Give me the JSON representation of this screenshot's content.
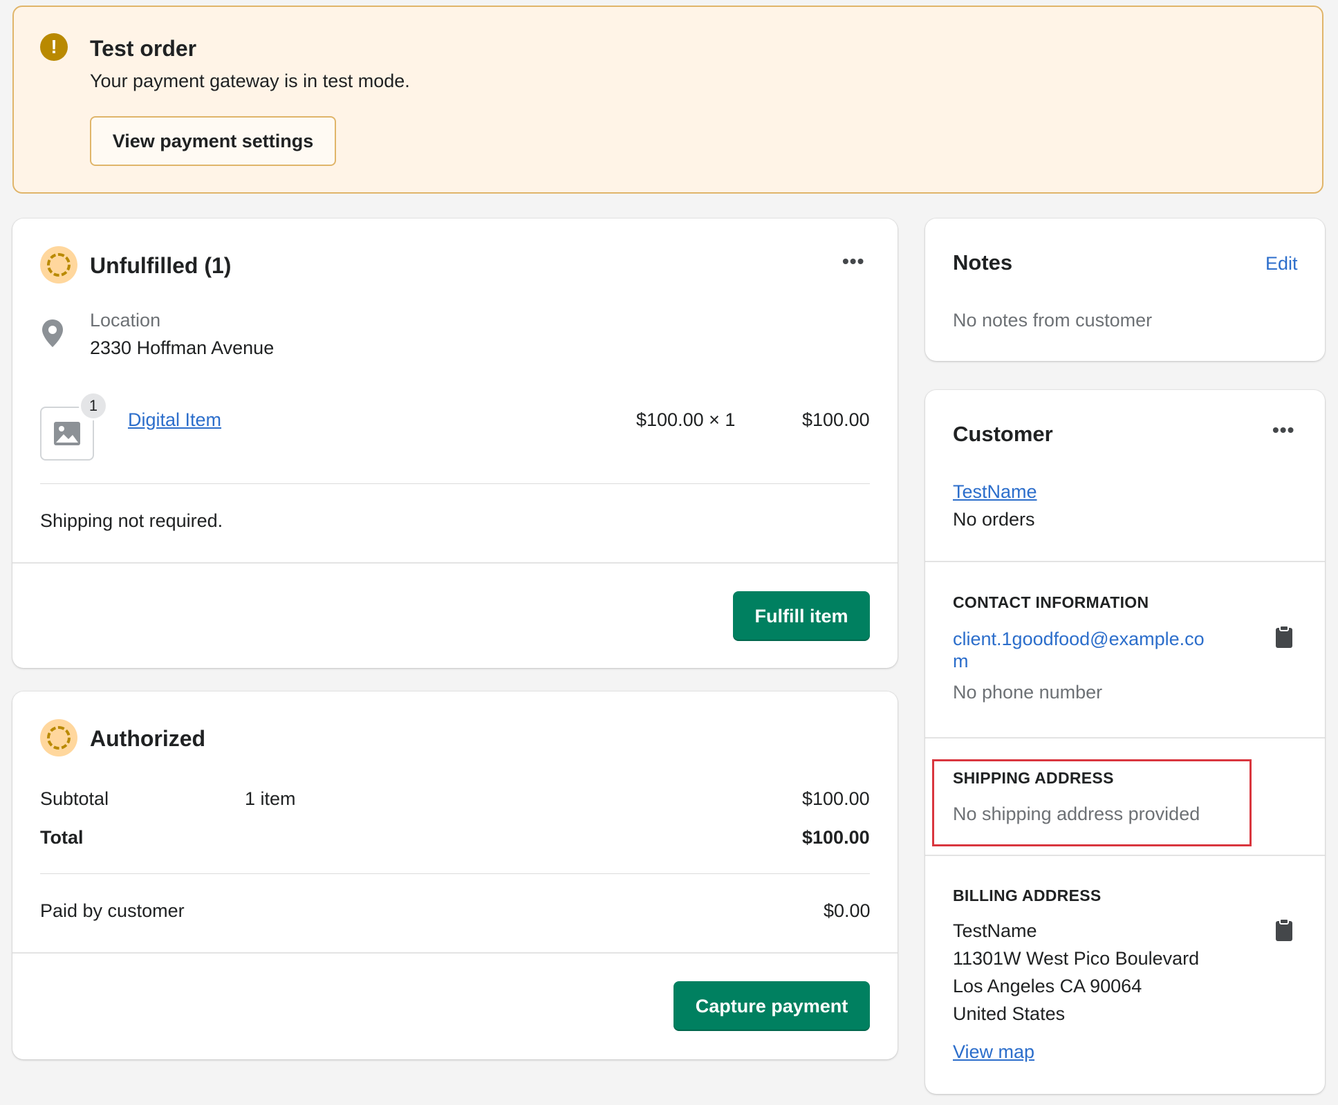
{
  "banner": {
    "title": "Test order",
    "message": "Your payment gateway is in test mode.",
    "button_label": "View payment settings",
    "icon": "warning-icon",
    "icon_glyph": "!"
  },
  "fulfillment": {
    "title": "Unfulfilled (1)",
    "more_label": "•••",
    "location_label": "Location",
    "location_value": "2330 Hoffman Avenue",
    "item": {
      "quantity_badge": "1",
      "name": "Digital Item",
      "unit_price": "$100.00 × 1",
      "line_total": "$100.00"
    },
    "shipping_note": "Shipping not required.",
    "action_label": "Fulfill item"
  },
  "payment": {
    "title": "Authorized",
    "subtotal_label": "Subtotal",
    "subtotal_items": "1 item",
    "subtotal_value": "$100.00",
    "total_label": "Total",
    "total_value": "$100.00",
    "paid_label": "Paid by customer",
    "paid_value": "$0.00",
    "action_label": "Capture payment"
  },
  "notes": {
    "title": "Notes",
    "edit_label": "Edit",
    "body": "No notes from customer"
  },
  "customer": {
    "title": "Customer",
    "more_label": "•••",
    "name": "TestName",
    "orders": "No orders",
    "contact_heading": "CONTACT INFORMATION",
    "email_line1": "client.1goodfood@example.co",
    "email_line2": "m",
    "phone": "No phone number",
    "shipping_heading": "SHIPPING ADDRESS",
    "shipping_value": "No shipping address provided",
    "billing_heading": "BILLING ADDRESS",
    "billing_lines": [
      "TestName",
      "11301W West Pico Boulevard",
      "Los Angeles CA 90064",
      "United States"
    ],
    "view_map_label": "View map"
  },
  "colors": {
    "primary": "#008060",
    "link": "#2c6ecb",
    "warning_bg": "#fff4e7",
    "warning_border": "#e0b56a",
    "highlight": "#d9363e"
  }
}
